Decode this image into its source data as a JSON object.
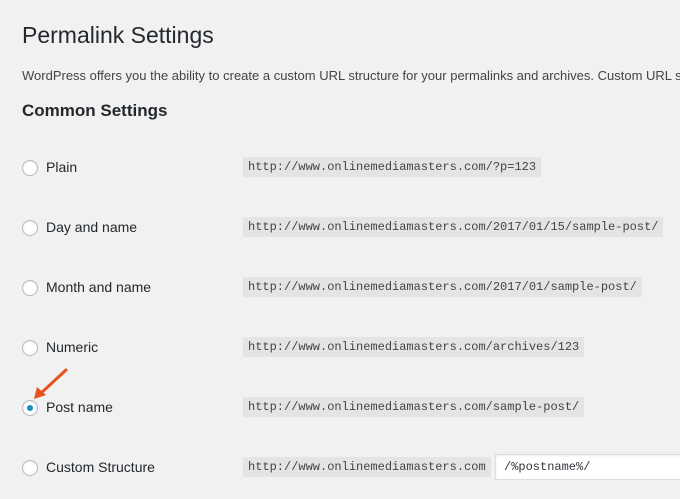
{
  "page": {
    "title": "Permalink Settings",
    "intro": "WordPress offers you the ability to create a custom URL structure for your permalinks and archives. Custom URL str",
    "section_title": "Common Settings"
  },
  "options": [
    {
      "label": "Plain",
      "example": "http://www.onlinemediamasters.com/?p=123",
      "checked": false
    },
    {
      "label": "Day and name",
      "example": "http://www.onlinemediamasters.com/2017/01/15/sample-post/",
      "checked": false
    },
    {
      "label": "Month and name",
      "example": "http://www.onlinemediamasters.com/2017/01/sample-post/",
      "checked": false
    },
    {
      "label": "Numeric",
      "example": "http://www.onlinemediamasters.com/archives/123",
      "checked": false
    },
    {
      "label": "Post name",
      "example": "http://www.onlinemediamasters.com/sample-post/",
      "checked": true
    },
    {
      "label": "Custom Structure",
      "example": "http://www.onlinemediamasters.com",
      "checked": false,
      "input_value": "/%postname%/"
    }
  ],
  "colors": {
    "background": "#f1f1f1",
    "code_background": "#e4e4e4",
    "radio_checked": "#1e8cbe",
    "arrow": "#e8501c"
  },
  "icons": {
    "annotation": "arrow-icon"
  }
}
